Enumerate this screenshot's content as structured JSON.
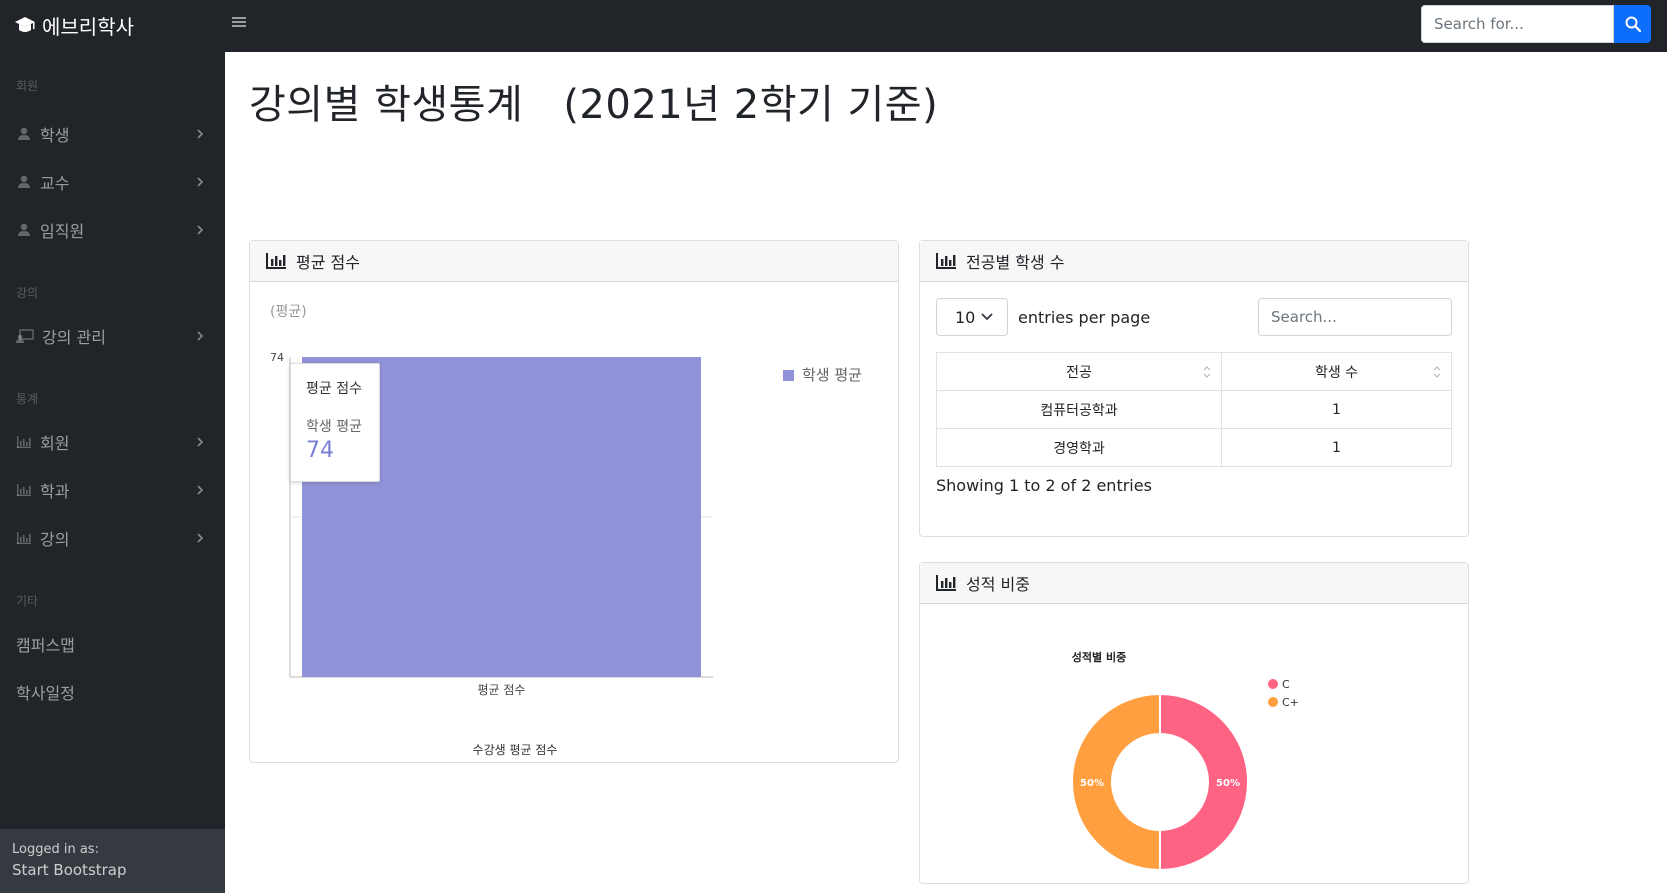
{
  "app": {
    "title": "에브리학사"
  },
  "search": {
    "placeholder": "Search for..."
  },
  "sidebar": {
    "sections": [
      {
        "heading": "회원",
        "items": [
          {
            "label": "학생"
          },
          {
            "label": "교수"
          },
          {
            "label": "임직원"
          }
        ]
      },
      {
        "heading": "강의",
        "items": [
          {
            "label": "강의 관리"
          }
        ]
      },
      {
        "heading": "통계",
        "items": [
          {
            "label": "회원"
          },
          {
            "label": "학과"
          },
          {
            "label": "강의"
          }
        ]
      },
      {
        "heading": "기타",
        "items": [
          {
            "label": "캠퍼스맵"
          },
          {
            "label": "학사일정"
          }
        ]
      }
    ],
    "footer": {
      "logged_in_label": "Logged in as:",
      "user": "Start Bootstrap"
    }
  },
  "page": {
    "title": "강의별 학생통계",
    "subtitle": "(2021년 2학기 기준)"
  },
  "avg_card": {
    "header": "평균 점수",
    "y_unit": "(평균)",
    "legend": "학생 평균",
    "x_category": "평균 점수",
    "x_title": "수강생 평균 점수",
    "tooltip": {
      "title": "평균 점수",
      "series": "학생 평균",
      "value": "74"
    },
    "bar_color": "#9193d9"
  },
  "major_card": {
    "header": "전공별 학생 수",
    "entries_value": "10",
    "entries_label": "entries per page",
    "search_placeholder": "Search...",
    "columns": [
      "전공",
      "학생 수"
    ],
    "rows": [
      [
        "컴퓨터공학과",
        "1"
      ],
      [
        "경영학과",
        "1"
      ]
    ],
    "info": "Showing 1 to 2 of 2 entries"
  },
  "grade_card": {
    "header": "성적 비중",
    "chart_title": "성적별 비중",
    "legend": [
      "C",
      "C+"
    ],
    "slice_labels": [
      "50%",
      "50%"
    ],
    "colors": {
      "C": "#ff6384",
      "C+": "#ff9f40"
    }
  },
  "chart_data": [
    {
      "type": "bar",
      "categories": [
        "평균 점수"
      ],
      "series": [
        {
          "name": "학생 평균",
          "values": [
            74
          ]
        }
      ],
      "title": "",
      "xlabel": "수강생 평균 점수",
      "ylabel": "(평균)",
      "ylim": [
        0,
        74
      ],
      "legend": "top-right",
      "grid": true
    },
    {
      "type": "pie",
      "title": "성적별 비중",
      "categories": [
        "C",
        "C+"
      ],
      "values": [
        50,
        50
      ],
      "legend": "right"
    }
  ]
}
